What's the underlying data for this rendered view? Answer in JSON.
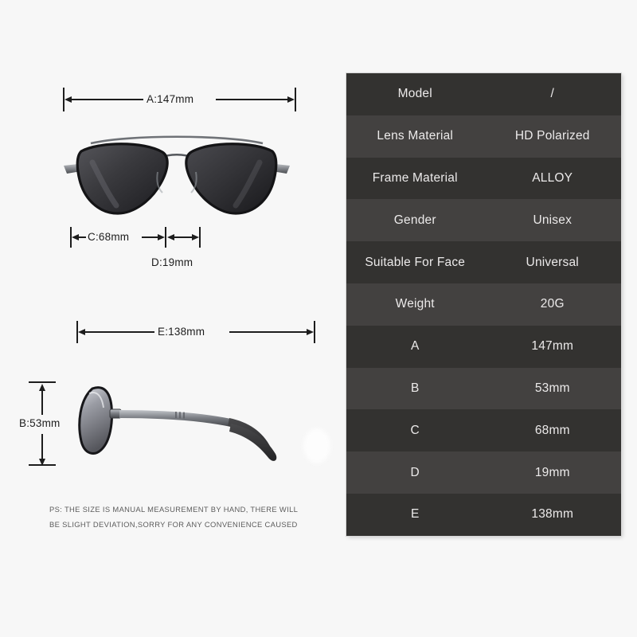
{
  "spec_table": {
    "rows": [
      {
        "key": "Model",
        "value": "/"
      },
      {
        "key": "Lens Material",
        "value": "HD Polarized"
      },
      {
        "key": "Frame Material",
        "value": "ALLOY"
      },
      {
        "key": "Gender",
        "value": "Unisex"
      },
      {
        "key": "Suitable For Face",
        "value": "Universal"
      },
      {
        "key": "Weight",
        "value": "20G"
      },
      {
        "key": "A",
        "value": "147mm"
      },
      {
        "key": "B",
        "value": "53mm"
      },
      {
        "key": "C",
        "value": "68mm"
      },
      {
        "key": "D",
        "value": "19mm"
      },
      {
        "key": "E",
        "value": "138mm"
      }
    ]
  },
  "diagrams": {
    "front_view": {
      "name": "sunglasses-front-view",
      "dimensions": {
        "a_label": "A:147mm",
        "c_label": "C:68mm",
        "d_label": "D:19mm"
      }
    },
    "side_view": {
      "name": "sunglasses-side-view",
      "dimensions": {
        "e_label": "E:138mm",
        "b_label": "B:53mm"
      }
    }
  },
  "disclaimer": {
    "line1": "PS: THE SIZE IS MANUAL MEASUREMENT BY HAND, THERE WILL",
    "line2": "BE SLIGHT DEVIATION,SORRY FOR ANY CONVENIENCE CAUSED"
  },
  "colors": {
    "background": "#f7f7f7",
    "row_dark": "#333230",
    "row_light": "#434140",
    "text_light": "#eceaea",
    "line": "#1d1d1d",
    "disclaimer_text": "#5c5c5c"
  }
}
